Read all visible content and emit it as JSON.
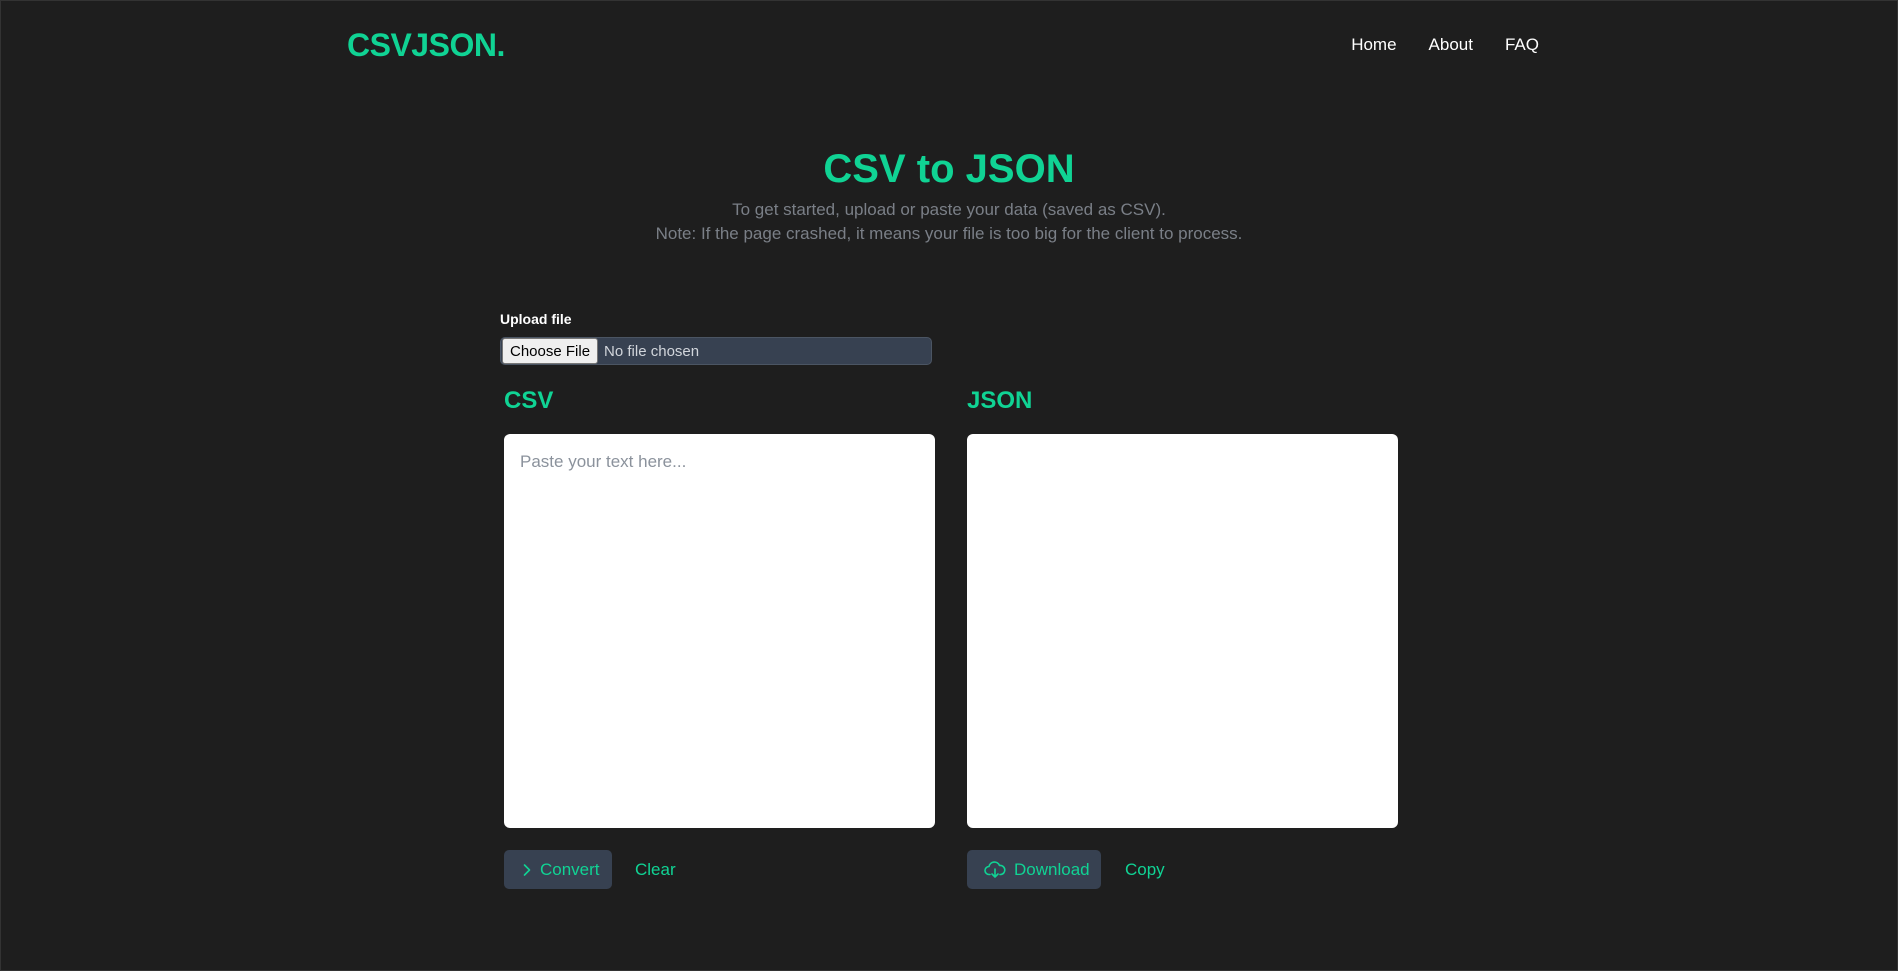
{
  "brand": {
    "logo": "CSVJSON."
  },
  "nav": {
    "items": [
      "Home",
      "About",
      "FAQ"
    ]
  },
  "hero": {
    "title": "CSV to JSON",
    "subtitle_line1": "To get started, upload or paste your data (saved as CSV).",
    "subtitle_line2": "Note: If the page crashed, it means your file is too big for the client to process."
  },
  "upload": {
    "label": "Upload file",
    "button_label": "Choose File",
    "status": "No file chosen"
  },
  "csv_panel": {
    "title": "CSV",
    "placeholder": "Paste your text here...",
    "value": "",
    "convert_label": "Convert",
    "clear_label": "Clear"
  },
  "json_panel": {
    "title": "JSON",
    "value": "",
    "download_label": "Download",
    "copy_label": "Copy"
  },
  "icons": {
    "convert": "chevron-right-icon",
    "download": "cloud-download-icon"
  },
  "colors": {
    "accent": "#10d394",
    "background": "#1e1e1e",
    "button_bg": "#374151",
    "muted_text": "#7a7f87"
  }
}
